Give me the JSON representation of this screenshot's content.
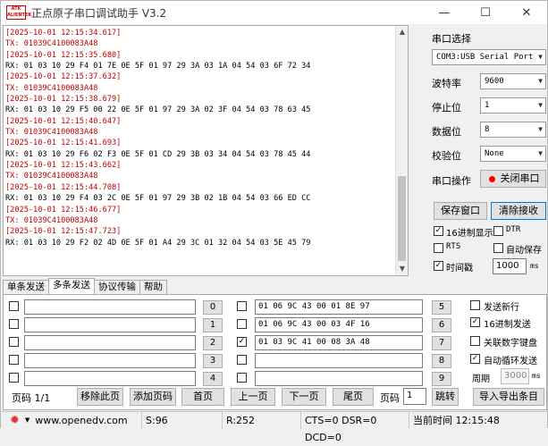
{
  "window": {
    "logo_text": "ATK",
    "title": "正点原子串口调试助手 V3.2",
    "minimize": "—",
    "maximize": "☐",
    "close": "✕"
  },
  "receive": {
    "lines": [
      {
        "kind": "ts",
        "text": "[2025-10-01 12:15:34.617]"
      },
      {
        "kind": "tx",
        "text": "TX: 01039C4100083A48"
      },
      {
        "kind": "ts",
        "text": "[2025-10-01 12:15:35.680]"
      },
      {
        "kind": "rx",
        "text": "RX: 01 03 10 29 F4 01 7E 0E 5F 01 97 29 3A 03 1A 04 54 03 6F 72 34"
      },
      {
        "kind": "ts",
        "text": "[2025-10-01 12:15:37.632]"
      },
      {
        "kind": "tx",
        "text": "TX: 01039C4100083A48"
      },
      {
        "kind": "ts",
        "text": "[2025-10-01 12:15:38.679]"
      },
      {
        "kind": "rx",
        "text": "RX: 01 03 10 29 F5 00 22 0E 5F 01 97 29 3A 02 3F 04 54 03 78 63 45"
      },
      {
        "kind": "ts",
        "text": "[2025-10-01 12:15:40.647]"
      },
      {
        "kind": "tx",
        "text": "TX: 01039C4100083A48"
      },
      {
        "kind": "ts",
        "text": "[2025-10-01 12:15:41.693]"
      },
      {
        "kind": "rx",
        "text": "RX: 01 03 10 29 F6 02 F3 0E 5F 01 CD 29 3B 03 34 04 54 03 78 45 44"
      },
      {
        "kind": "ts",
        "text": "[2025-10-01 12:15:43.662]"
      },
      {
        "kind": "tx",
        "text": "TX: 01039C4100083A48"
      },
      {
        "kind": "ts",
        "text": "[2025-10-01 12:15:44.708]"
      },
      {
        "kind": "rx",
        "text": "RX: 01 03 10 29 F4 03 2C 0E 5F 01 97 29 3B 02 1B 04 54 03 66 ED CC"
      },
      {
        "kind": "ts",
        "text": "[2025-10-01 12:15:46.677]"
      },
      {
        "kind": "tx",
        "text": "TX: 01039C4100083A48"
      },
      {
        "kind": "ts",
        "text": "[2025-10-01 12:15:47.723]"
      },
      {
        "kind": "rx",
        "text": "RX: 01 03 10 29 F2 02 4D 0E 5F 01 A4 29 3C 01 32 04 54 03 5E 45 79"
      }
    ]
  },
  "panel": {
    "port_select_label": "串口选择",
    "port_value": "COM3:USB Serial Port",
    "baud_label": "波特率",
    "baud_value": "9600",
    "stop_label": "停止位",
    "stop_value": "1",
    "data_label": "数据位",
    "data_value": "8",
    "parity_label": "校验位",
    "parity_value": "None",
    "op_label": "串口操作",
    "close_port_label": "关闭串口",
    "save_window_label": "保存窗口",
    "clear_recv_label": "清除接收",
    "hex_display_label": "16进制显示",
    "dtr_label": "DTR",
    "rts_label": "RTS",
    "auto_save_label": "自动保存",
    "timestamp_label": "时间戳",
    "timestamp_value": "1000",
    "timestamp_unit": "ms"
  },
  "tabs": [
    "单条发送",
    "多条发送",
    "协议传输",
    "帮助"
  ],
  "multi": {
    "left_rows": [
      {
        "num": "0",
        "text": ""
      },
      {
        "num": "1",
        "text": ""
      },
      {
        "num": "2",
        "text": ""
      },
      {
        "num": "3",
        "text": ""
      },
      {
        "num": "4",
        "text": ""
      }
    ],
    "right_rows": [
      {
        "num": "5",
        "text": "01 06 9C 43 00 01 8E 97",
        "checked": false
      },
      {
        "num": "6",
        "text": "01 06 9C 43 00 03 4F 16",
        "checked": false
      },
      {
        "num": "7",
        "text": "01 03 9C 41 00 08 3A 48",
        "checked": true
      },
      {
        "num": "8",
        "text": "",
        "checked": false
      },
      {
        "num": "9",
        "text": "",
        "checked": false
      }
    ],
    "send_newline_label": "发送新行",
    "hex_send_label": "16进制发送",
    "link_keyboard_label": "关联数字键盘",
    "auto_loop_label": "自动循环发送",
    "period_label": "周期",
    "period_value": "3000",
    "period_unit": "ms",
    "page_label": "页码 1/1",
    "remove_page_label": "移除此页",
    "add_page_label": "添加页码",
    "first_page_label": "首页",
    "prev_page_label": "上一页",
    "next_page_label": "下一页",
    "last_page_label": "尾页",
    "page_input_label": "页码",
    "page_input_value": "1",
    "jump_label": "跳转",
    "import_export_label": "导入导出条目"
  },
  "status": {
    "url": "www.openedv.com",
    "sent": "S:96",
    "recv": "R:252",
    "lines": "CTS=0 DSR=0 DCD=0",
    "time": "当前时间 12:15:48"
  }
}
